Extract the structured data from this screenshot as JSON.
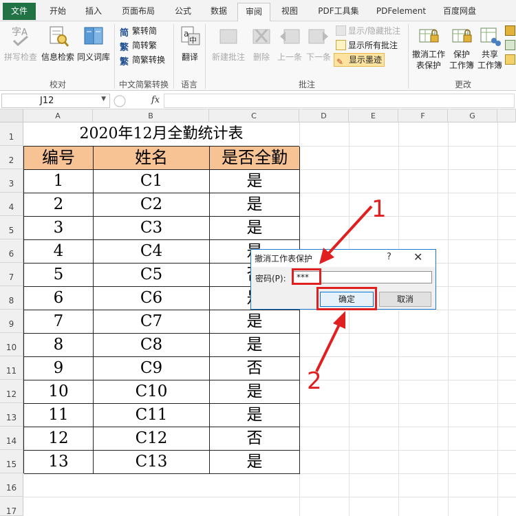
{
  "ribbon_tabs": [
    {
      "label": "文件"
    },
    {
      "label": "开始"
    },
    {
      "label": "插入"
    },
    {
      "label": "页面布局"
    },
    {
      "label": "公式"
    },
    {
      "label": "数据"
    },
    {
      "label": "审阅"
    },
    {
      "label": "视图"
    },
    {
      "label": "PDF工具集"
    },
    {
      "label": "PDFelement"
    },
    {
      "label": "百度网盘"
    }
  ],
  "active_tab": "审阅",
  "ribbon": {
    "proofing": {
      "title": "校对",
      "spell": "拼写检查",
      "research": "信息检索",
      "thesaurus": "同义词库"
    },
    "chinese": {
      "title": "中文简繁转换",
      "to_simplified": "繁转简",
      "to_traditional": "简转繁",
      "convert": "简繁转换"
    },
    "language": {
      "title": "语言",
      "translate": "翻译"
    },
    "comments": {
      "title": "批注",
      "new": "新建批注",
      "delete": "删除",
      "prev": "上一条",
      "next": "下一条",
      "show_hide": "显示/隐藏批注",
      "show_all": "显示所有批注",
      "show_ink": "显示墨迹"
    },
    "changes": {
      "title": "更改",
      "unprotect_sheet_1": "撤消工作",
      "unprotect_sheet_2": "表保护",
      "protect_wb_1": "保护",
      "protect_wb_2": "工作簿",
      "share_wb_1": "共享",
      "share_wb_2": "工作簿"
    }
  },
  "formula_bar": {
    "name_box": "J12",
    "fx": "fx",
    "content": ""
  },
  "columns": [
    "A",
    "B",
    "C",
    "D",
    "E",
    "F",
    "G"
  ],
  "rows": [
    "1",
    "2",
    "3",
    "4",
    "5",
    "6",
    "7",
    "8",
    "9",
    "10",
    "11",
    "12",
    "13",
    "14",
    "15",
    "16",
    "17"
  ],
  "sheet": {
    "title": "2020年12月全勤统计表",
    "headers": [
      "编号",
      "姓名",
      "是否全勤"
    ],
    "records": [
      [
        "1",
        "C1",
        "是"
      ],
      [
        "2",
        "C2",
        "是"
      ],
      [
        "3",
        "C3",
        "是"
      ],
      [
        "4",
        "C4",
        "是"
      ],
      [
        "5",
        "C5",
        "否"
      ],
      [
        "6",
        "C6",
        "是"
      ],
      [
        "7",
        "C7",
        "是"
      ],
      [
        "8",
        "C8",
        "是"
      ],
      [
        "9",
        "C9",
        "否"
      ],
      [
        "10",
        "C10",
        "是"
      ],
      [
        "11",
        "C11",
        "是"
      ],
      [
        "12",
        "C12",
        "否"
      ],
      [
        "13",
        "C13",
        "是"
      ]
    ]
  },
  "dialog": {
    "title": "撤消工作表保护",
    "help": "?",
    "close": "✕",
    "password_label": "密码(P):",
    "password_value": "***",
    "ok": "确定",
    "cancel": "取消"
  },
  "annotations": {
    "step1": "1",
    "step2": "2",
    "color": "#e02020"
  },
  "colors": {
    "header_fill": "#f7c294",
    "file_tab": "#217346",
    "dialog_border": "#1e7ad4"
  }
}
